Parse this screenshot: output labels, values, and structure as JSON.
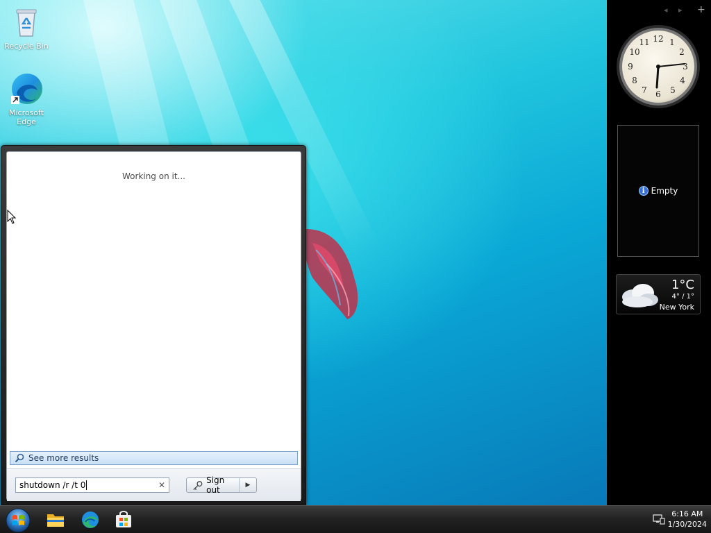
{
  "desktop": {
    "icons": [
      {
        "label": "Recycle Bin",
        "icon": "recycle-bin-icon"
      },
      {
        "label": "Microsoft Edge",
        "icon": "edge-icon"
      }
    ]
  },
  "sidebar": {
    "controls": {
      "prev": "◂",
      "next": "▸",
      "add": "+"
    },
    "clock": {
      "time": "6:16"
    },
    "empty_gadget": {
      "label": "Empty"
    },
    "weather": {
      "temp": "1°C",
      "range": "4° / 1°",
      "city": "New York"
    }
  },
  "start_menu": {
    "status": "Working on it...",
    "see_more": "See more results",
    "search": {
      "value": "shutdown /r /t 0"
    },
    "sign_out": "Sign out"
  },
  "taskbar": {
    "apps": [
      "file-explorer-icon",
      "edge-icon",
      "store-icon"
    ],
    "time": "6:16 AM",
    "date": "1/30/2024"
  }
}
